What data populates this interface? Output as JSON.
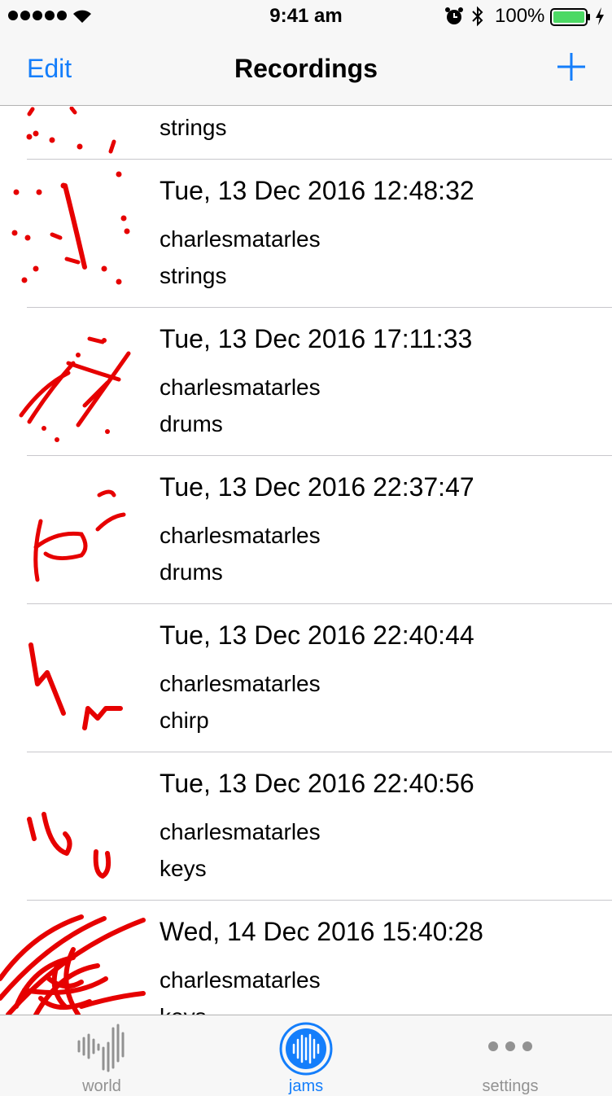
{
  "status_bar": {
    "time": "9:41 am",
    "battery_percent": "100%"
  },
  "nav": {
    "edit_label": "Edit",
    "title": "Recordings"
  },
  "recordings": [
    {
      "date": "",
      "user": "",
      "instrument": "strings"
    },
    {
      "date": "Tue, 13 Dec 2016 12:48:32",
      "user": "charlesmatarles",
      "instrument": "strings"
    },
    {
      "date": "Tue, 13 Dec 2016 17:11:33",
      "user": "charlesmatarles",
      "instrument": "drums"
    },
    {
      "date": "Tue, 13 Dec 2016 22:37:47",
      "user": "charlesmatarles",
      "instrument": "drums"
    },
    {
      "date": "Tue, 13 Dec 2016 22:40:44",
      "user": "charlesmatarles",
      "instrument": "chirp"
    },
    {
      "date": "Tue, 13 Dec 2016 22:40:56",
      "user": "charlesmatarles",
      "instrument": "keys"
    },
    {
      "date": "Wed, 14 Dec 2016 15:40:28",
      "user": "charlesmatarles",
      "instrument": "keys"
    }
  ],
  "tabs": [
    {
      "label": "world",
      "icon": "waveform-icon",
      "active": false
    },
    {
      "label": "jams",
      "icon": "waveform-circle-icon",
      "active": true
    },
    {
      "label": "settings",
      "icon": "more-icon",
      "active": false
    }
  ],
  "colors": {
    "accent": "#147efb",
    "drawing": "#e60000",
    "battery": "#4cd964",
    "inactive": "#929292"
  }
}
